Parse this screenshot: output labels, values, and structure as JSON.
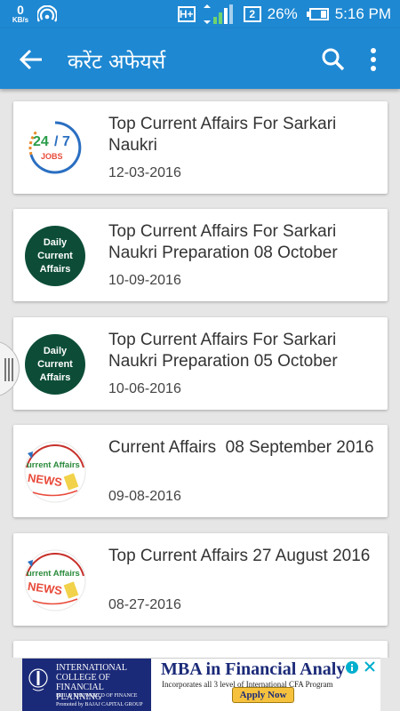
{
  "status_bar": {
    "net_speed_value": "0",
    "net_speed_unit": "KB/s",
    "network_type": "H+",
    "sim_badge": "2",
    "battery": "26%",
    "time": "5:16 PM"
  },
  "app_bar": {
    "title": "करेंट अफेयर्स",
    "back_icon": "arrow-back-icon",
    "search_icon": "search-icon",
    "more_icon": "more-vert-icon"
  },
  "items": [
    {
      "title": "Top Current Affairs For Sarkari Naukri",
      "date": "12-03-2016"
    },
    {
      "title": "Top Current Affairs For Sarkari Naukri Preparation 08 October",
      "date": "10-09-2016"
    },
    {
      "title": "Top Current Affairs For Sarkari Naukri Preparation 05 October",
      "date": "10-06-2016"
    },
    {
      "title": "Current Affairs  08 September 2016",
      "date": "09-08-2016"
    },
    {
      "title": "Top Current Affairs 27 August 2016",
      "date": "08-27-2016"
    }
  ],
  "thumbs": {
    "jobs": {
      "n1": "24",
      "n2": "7",
      "word": "JOBS"
    },
    "daily": {
      "l1": "Daily",
      "l2": "Current",
      "l3": "Affairs"
    },
    "ca": {
      "l1": "urrent Affairs",
      "l2": "NEWS"
    }
  },
  "ad": {
    "logo_line1": "INTERNATIONAL COLLEGE OF FINANCIAL PLANNING",
    "logo_line2": "BUILD THE WORLD OF FINANCE",
    "logo_line3": "Promoted by BAJAJ CAPITAL GROUP",
    "headline": "MBA in Financial Analy",
    "subline": "Incorporates all 3 level of International CFA Program",
    "cta": "Apply Now",
    "colors": {
      "navy": "#1b2a78",
      "cta": "#f6c23e"
    }
  },
  "colors": {
    "primary": "#1e88d2",
    "background": "#e6e6e6",
    "card": "#ffffff",
    "daily_badge": "#0d4d38"
  }
}
